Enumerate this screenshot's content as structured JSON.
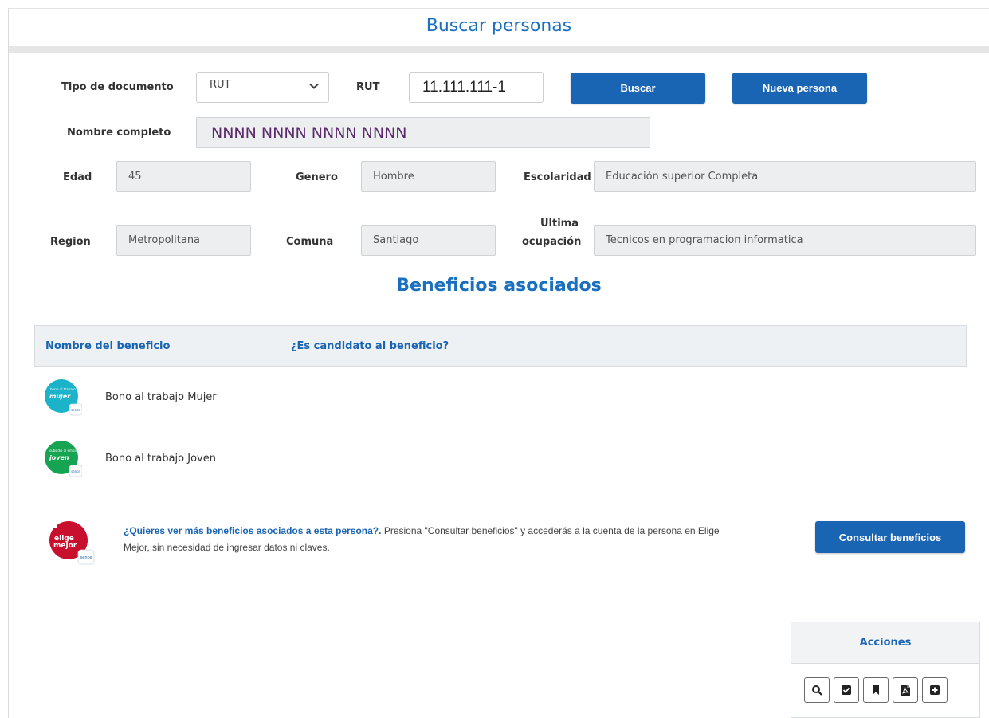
{
  "header": {
    "title": "Buscar personas"
  },
  "search": {
    "doc_type_label": "Tipo de documento",
    "doc_type_value": "RUT",
    "rut_label": "RUT",
    "rut_value": "11.111.111-1",
    "search_button": "Buscar",
    "new_person_button": "Nueva persona"
  },
  "person": {
    "full_name_label": "Nombre completo",
    "full_name_value": "NNNN NNNN NNNN NNNN",
    "age_label": "Edad",
    "age_value": "45",
    "gender_label": "Genero",
    "gender_value": "Hombre",
    "schooling_label": "Escolaridad",
    "schooling_value": "Educación superior Completa",
    "region_label": "Region",
    "region_value": "Metropolitana",
    "commune_label": "Comuna",
    "commune_value": "Santiago",
    "last_job_label_1": "Ultima",
    "last_job_label_2": "ocupación",
    "last_job_value": "Tecnicos en programacion informatica"
  },
  "benefits": {
    "title": "Beneficios asociados",
    "col_name": "Nombre del beneficio",
    "col_candidate": "¿Es candidato al beneficio?",
    "items": [
      {
        "name": "Bono al trabajo Mujer",
        "logo_text_small": "bono al trabajo",
        "logo_text_big": "mujer",
        "color": "#1bb3c9"
      },
      {
        "name": "Bono al trabajo Joven",
        "logo_text_small": "subsidio al empleo",
        "logo_text_big": "joven",
        "color": "#16a452"
      }
    ]
  },
  "promo": {
    "logo_line1": "elige",
    "logo_line2": "mejor",
    "question": "¿Quieres ver más beneficios asociados a esta persona?.",
    "text": " Presiona \"Consultar beneficios\" y accederás a la cuenta de la persona en Elige Mejor, sin necesidad de ingresar datos ni claves.",
    "button": "Consultar beneficios",
    "color": "#c8102e"
  },
  "actions": {
    "title": "Acciones",
    "icons": [
      "search-icon",
      "check-square-icon",
      "bookmark-icon",
      "pdf-icon",
      "plus-square-icon"
    ]
  },
  "colors": {
    "accent": "#1a64b4",
    "title": "#1a6fbf",
    "field_bg": "#eceef0"
  }
}
